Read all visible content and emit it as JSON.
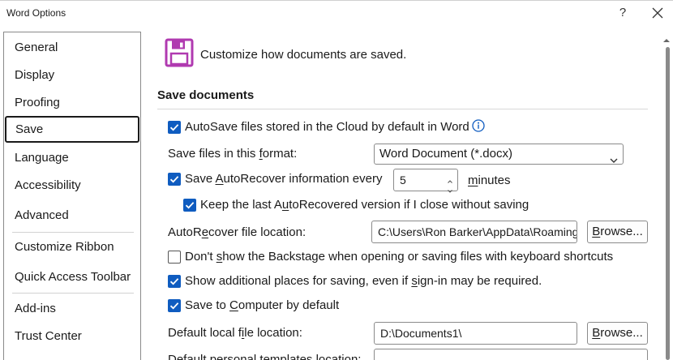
{
  "window": {
    "title": "Word Options",
    "help_label": "?"
  },
  "sidebar": {
    "items": [
      {
        "label": "General",
        "selected": false
      },
      {
        "label": "Display",
        "selected": false
      },
      {
        "label": "Proofing",
        "selected": false
      },
      {
        "label": "Save",
        "selected": true
      },
      {
        "label": "Language",
        "selected": false
      },
      {
        "label": "Accessibility",
        "selected": false
      },
      {
        "label": "Advanced",
        "selected": false
      },
      {
        "label": "Customize Ribbon",
        "selected": false
      },
      {
        "label": "Quick Access Toolbar",
        "selected": false
      },
      {
        "label": "Add-ins",
        "selected": false
      },
      {
        "label": "Trust Center",
        "selected": false
      }
    ]
  },
  "header": {
    "text": "Customize how documents are saved."
  },
  "section": {
    "title": "Save documents"
  },
  "options": {
    "autosave_cloud": {
      "checked": true,
      "label": "AutoSave files stored in the Cloud by default in Word"
    },
    "format": {
      "label_pre": "Save files in this ",
      "label_u": "f",
      "label_post": "ormat:",
      "value": "Word Document (*.docx)"
    },
    "autorecover": {
      "checked": true,
      "label_pre": "Save ",
      "label_u": "A",
      "label_post": "utoRecover information every",
      "minutes_value": "5",
      "minutes_pre": "",
      "minutes_u": "m",
      "minutes_post": "inutes"
    },
    "keep_last": {
      "checked": true,
      "label_pre": "Keep the last A",
      "label_u": "u",
      "label_post": "toRecovered version if I close without saving"
    },
    "autorecover_location": {
      "label_pre": "AutoR",
      "label_u": "e",
      "label_post": "cover file location:",
      "value": "C:\\Users\\Ron Barker\\AppData\\Roaming",
      "browse_pre": "",
      "browse_u": "B",
      "browse_post": "rowse..."
    },
    "backstage": {
      "checked": false,
      "label_pre": "Don't ",
      "label_u": "s",
      "label_post": "how the Backstage when opening or saving files with keyboard shortcuts"
    },
    "additional_places": {
      "checked": true,
      "label_pre": "Show additional places for saving, even if ",
      "label_u": "s",
      "label_post": "ign-in may be required."
    },
    "save_to_computer": {
      "checked": true,
      "label_pre": "Save to ",
      "label_u": "C",
      "label_post": "omputer by default"
    },
    "default_local": {
      "label_pre": "Default local f",
      "label_u": "i",
      "label_post": "le location:",
      "value": "D:\\Documents1\\",
      "browse_pre": "",
      "browse_u": "B",
      "browse_post": "rowse..."
    },
    "default_templates": {
      "label": "Default personal templates location:",
      "value": ""
    }
  },
  "colors": {
    "accent": "#0f5cc0",
    "save_icon": "#b03ab0"
  }
}
